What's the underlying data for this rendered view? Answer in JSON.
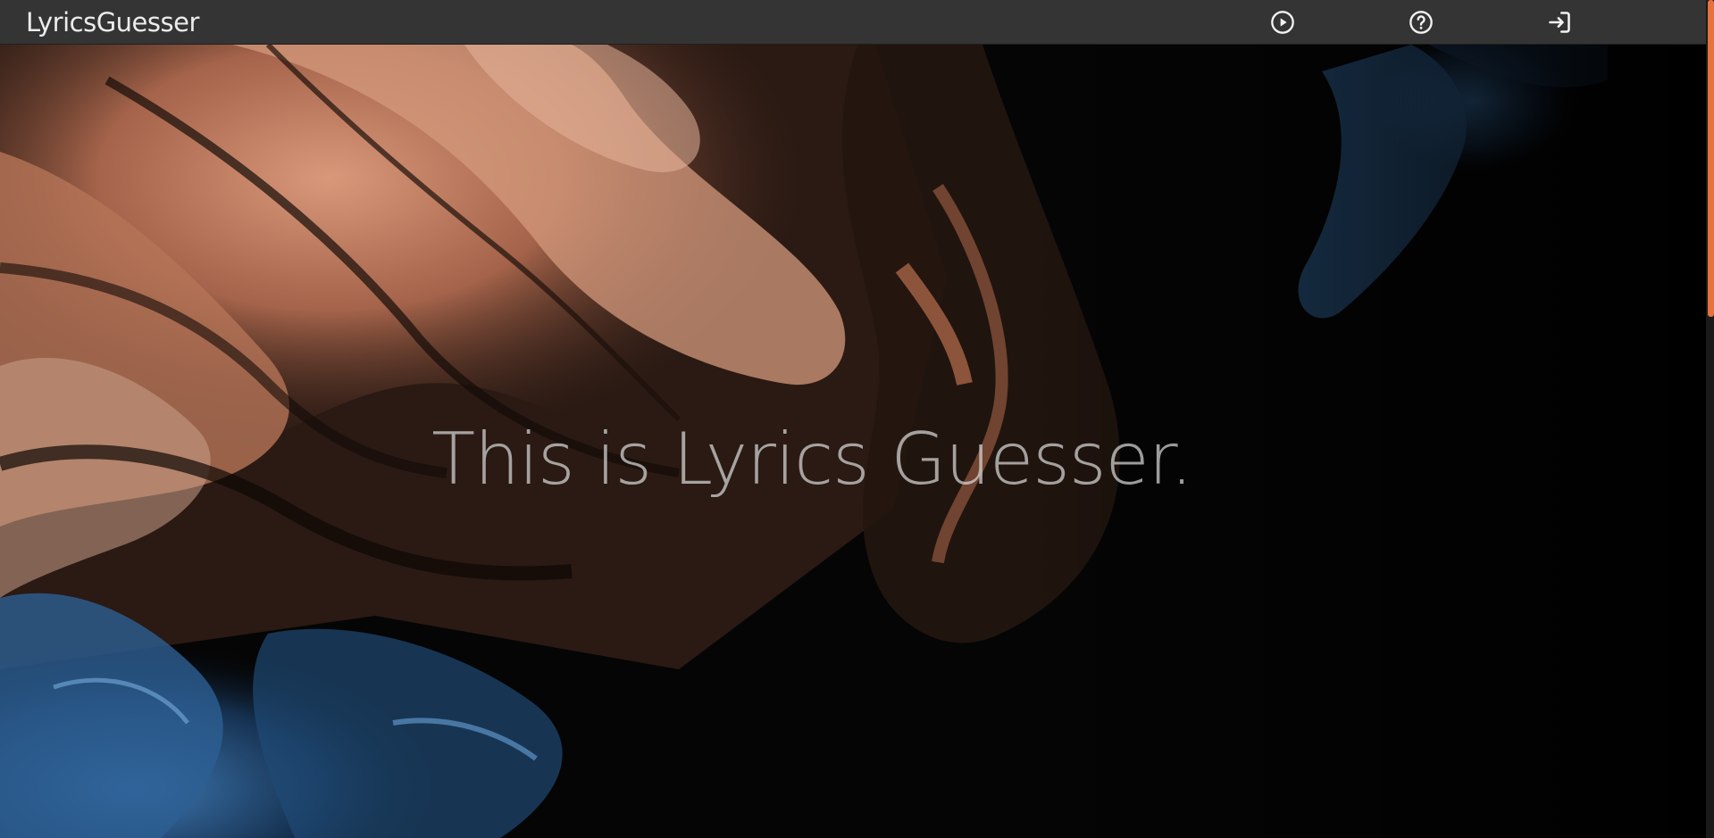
{
  "navbar": {
    "brand": "LyricsGuesser",
    "icons": {
      "play": "play-circle-icon",
      "help": "question-circle-icon",
      "login": "sign-in-icon"
    }
  },
  "hero": {
    "title": "This is Lyrics Guesser."
  },
  "colors": {
    "navbar_bg": "#343434",
    "accent": "#e8713c",
    "copper": "#c9896a",
    "blue": "#2d5f93"
  }
}
